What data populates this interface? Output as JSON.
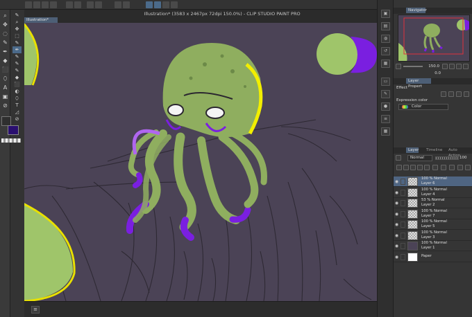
{
  "app": {
    "window_title": "Illustration* (3583 x 2467px 72dpi 150.0%) - CLIP STUDIO PAINT PRO",
    "canvas_tab": "Illustration*"
  },
  "tools": [
    "⌕",
    "✥",
    "◌",
    "✎",
    "✒",
    "◆",
    "⬛",
    "⬯",
    "A",
    "▣",
    "⊘"
  ],
  "subtools": [
    "✎",
    "⌕",
    "✥",
    "⬚",
    "✎",
    "✒",
    "✎",
    "✎",
    "✎",
    "◆",
    "⬛",
    "◐",
    "⬯",
    "T",
    "◿",
    "⊘"
  ],
  "colors": {
    "main": "#2f2f2f",
    "sub": "#2a0f6f",
    "accent": "#4b6a8a"
  },
  "panels": {
    "navigator": {
      "tab": "Navigator",
      "zoom": "150.0",
      "rotation": "0.0"
    },
    "layer_property": {
      "tab": "Layer Propert",
      "effect_label": "Effect",
      "expression_color_label": "Expression color",
      "expression_color_value": "Color"
    },
    "layer": {
      "tabs": [
        "Layer",
        "Timeline",
        "Auto Action"
      ],
      "blend_mode": "Normal",
      "opacity": "100",
      "layers": [
        {
          "opacity_mode": "100 % Normal",
          "name": "Layer 6",
          "selected": true
        },
        {
          "opacity_mode": "100 % Normal",
          "name": "Layer 4",
          "selected": false
        },
        {
          "opacity_mode": "53 % Normal",
          "name": "Layer 2",
          "selected": false
        },
        {
          "opacity_mode": "100 % Normal",
          "name": "Layer 7",
          "selected": false
        },
        {
          "opacity_mode": "100 % Normal",
          "name": "Layer 5",
          "selected": false
        },
        {
          "opacity_mode": "100 % Normal",
          "name": "Layer 3",
          "selected": false
        },
        {
          "opacity_mode": "100 % Normal",
          "name": "Layer 1",
          "selected": false
        },
        {
          "opacity_mode": "",
          "name": "Paper",
          "selected": false
        }
      ]
    }
  },
  "icons": {
    "layer_eye": "eye-icon",
    "strip": [
      "navigator-icon",
      "layer-property-icon",
      "color-wheel-icon",
      "history-icon",
      "material-icon",
      "sub-view-icon",
      "tool-property-icon",
      "brush-size-icon",
      "color-slider-icon",
      "color-set-icon",
      "layer-search-icon",
      "timeline-icon"
    ]
  }
}
